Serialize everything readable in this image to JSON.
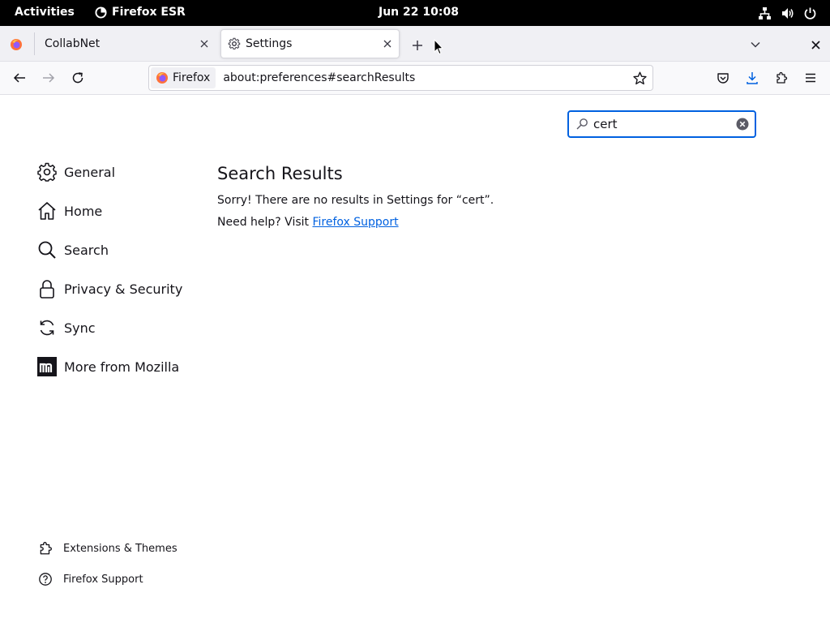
{
  "topbar": {
    "activities": "Activities",
    "app_name": "Firefox ESR",
    "clock": "Jun 22  10:08"
  },
  "tabs": [
    {
      "label": "CollabNet",
      "active": false
    },
    {
      "label": "Settings",
      "active": true
    }
  ],
  "urlbar": {
    "identity_label": "Firefox",
    "url": "about:preferences#searchResults"
  },
  "search": {
    "value": "cert"
  },
  "sidebar": {
    "items": [
      {
        "label": "General",
        "icon": "gear-icon"
      },
      {
        "label": "Home",
        "icon": "home-icon"
      },
      {
        "label": "Search",
        "icon": "search-icon"
      },
      {
        "label": "Privacy & Security",
        "icon": "lock-icon"
      },
      {
        "label": "Sync",
        "icon": "sync-icon"
      },
      {
        "label": "More from Mozilla",
        "icon": "mozilla-icon"
      }
    ],
    "footer": [
      {
        "label": "Extensions & Themes",
        "icon": "puzzle-icon"
      },
      {
        "label": "Firefox Support",
        "icon": "help-icon"
      }
    ]
  },
  "main": {
    "title": "Search Results",
    "no_results": "Sorry! There are no results in Settings for “cert”.",
    "help_prefix": "Need help? Visit ",
    "help_link": "Firefox Support"
  },
  "colors": {
    "accent": "#0061e0",
    "topbar": "#000000",
    "tabstrip": "#f0f0f4"
  }
}
